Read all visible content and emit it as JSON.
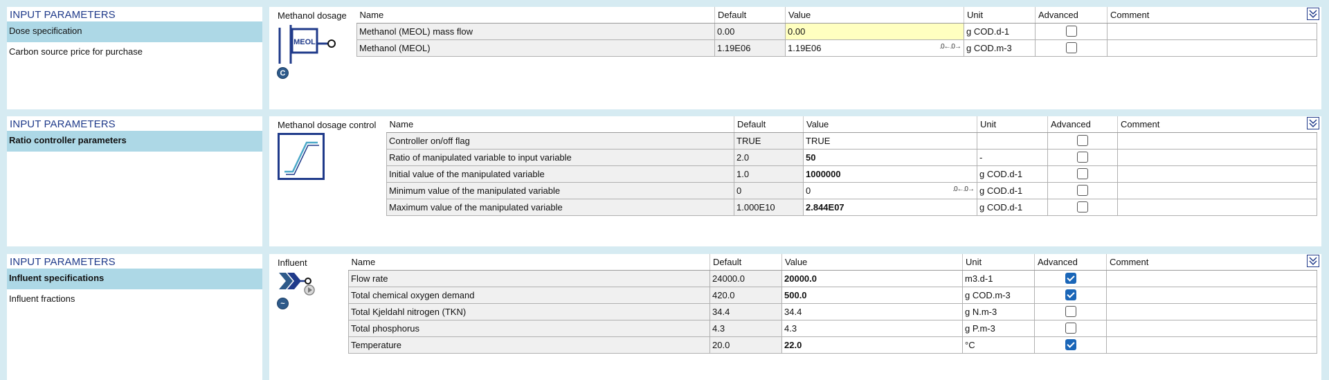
{
  "panels": [
    {
      "title": "INPUT PARAMETERS",
      "nav": [
        {
          "label": "Dose specification",
          "selected": true,
          "bold": false
        },
        {
          "label": "Carbon source price for purchase",
          "selected": false,
          "bold": false
        }
      ],
      "component_label": "Methanol dosage",
      "icon": "methanol-dosage-icon",
      "icon_text": "MEOL",
      "badge": "C",
      "columns": [
        "Name",
        "Default",
        "Value",
        "Unit",
        "Advanced",
        "Comment"
      ],
      "rows": [
        {
          "name": "Methanol (MEOL) mass flow",
          "default": "0.00",
          "value": "0.00",
          "unit": "g COD.d-1",
          "advanced": false,
          "highlight": true,
          "bold": false,
          "spin": false
        },
        {
          "name": "Methanol (MEOL)",
          "default": "1.19E06",
          "value": "1.19E06",
          "unit": "g COD.m-3",
          "advanced": false,
          "highlight": false,
          "bold": false,
          "spin": true
        }
      ]
    },
    {
      "title": "INPUT PARAMETERS",
      "nav": [
        {
          "label": "Ratio controller parameters",
          "selected": true,
          "bold": true
        }
      ],
      "component_label": "Methanol dosage control",
      "icon": "ratio-controller-icon",
      "columns": [
        "Name",
        "Default",
        "Value",
        "Unit",
        "Advanced",
        "Comment"
      ],
      "rows": [
        {
          "name": "Controller on/off flag",
          "default": "TRUE",
          "value": "TRUE",
          "unit": "",
          "advanced": false,
          "highlight": false,
          "bold": false,
          "spin": false
        },
        {
          "name": "Ratio of manipulated variable to input variable",
          "default": "2.0",
          "value": "50",
          "unit": "-",
          "advanced": false,
          "highlight": false,
          "bold": true,
          "spin": false
        },
        {
          "name": "Initial value of the manipulated variable",
          "default": "1.0",
          "value": "1000000",
          "unit": "g COD.d-1",
          "advanced": false,
          "highlight": false,
          "bold": true,
          "spin": false
        },
        {
          "name": "Minimum value of the manipulated variable",
          "default": "0",
          "value": "0",
          "unit": "g COD.d-1",
          "advanced": false,
          "highlight": false,
          "bold": false,
          "spin": true
        },
        {
          "name": "Maximum value of the manipulated variable",
          "default": "1.000E10",
          "value": "2.844E07",
          "unit": "g COD.d-1",
          "advanced": false,
          "highlight": false,
          "bold": true,
          "spin": false
        }
      ]
    },
    {
      "title": "INPUT PARAMETERS",
      "nav": [
        {
          "label": "Influent specifications",
          "selected": true,
          "bold": true
        },
        {
          "label": "Influent fractions",
          "selected": false,
          "bold": false
        }
      ],
      "component_label": "Influent",
      "icon": "influent-icon",
      "badge": "~",
      "columns": [
        "Name",
        "Default",
        "Value",
        "Unit",
        "Advanced",
        "Comment"
      ],
      "rows": [
        {
          "name": "Flow rate",
          "default": "24000.0",
          "value": "20000.0",
          "unit": "m3.d-1",
          "advanced": true,
          "highlight": false,
          "bold": true,
          "spin": false
        },
        {
          "name": "Total chemical oxygen demand",
          "default": "420.0",
          "value": "500.0",
          "unit": "g COD.m-3",
          "advanced": true,
          "highlight": false,
          "bold": true,
          "spin": false
        },
        {
          "name": "Total Kjeldahl nitrogen (TKN)",
          "default": "34.4",
          "value": "34.4",
          "unit": "g N.m-3",
          "advanced": false,
          "highlight": false,
          "bold": false,
          "spin": false
        },
        {
          "name": "Total phosphorus",
          "default": "4.3",
          "value": "4.3",
          "unit": "g P.m-3",
          "advanced": false,
          "highlight": false,
          "bold": false,
          "spin": false
        },
        {
          "name": "Temperature",
          "default": "20.0",
          "value": "22.0",
          "unit": "°C",
          "advanced": true,
          "highlight": false,
          "bold": true,
          "spin": false
        }
      ]
    }
  ],
  "spin_glyph": ".0←.0→"
}
